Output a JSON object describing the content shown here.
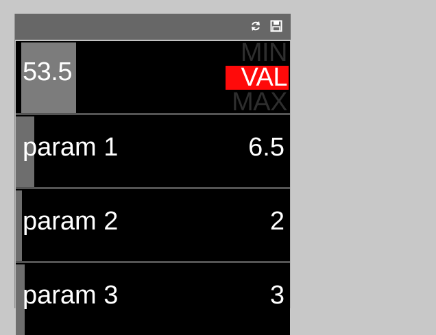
{
  "titlebar": {
    "icons": [
      "refresh-icon",
      "save-icon"
    ]
  },
  "main_slider": {
    "value": "53.5",
    "modes": {
      "min": "MIN",
      "val": "VAL",
      "max": "MAX"
    },
    "selected_mode": "VAL",
    "active_color": "#ff0a0a"
  },
  "params": [
    {
      "label": "param 1",
      "value": "6.5"
    },
    {
      "label": "param 2",
      "value": "2"
    },
    {
      "label": "param 3",
      "value": "3"
    }
  ]
}
